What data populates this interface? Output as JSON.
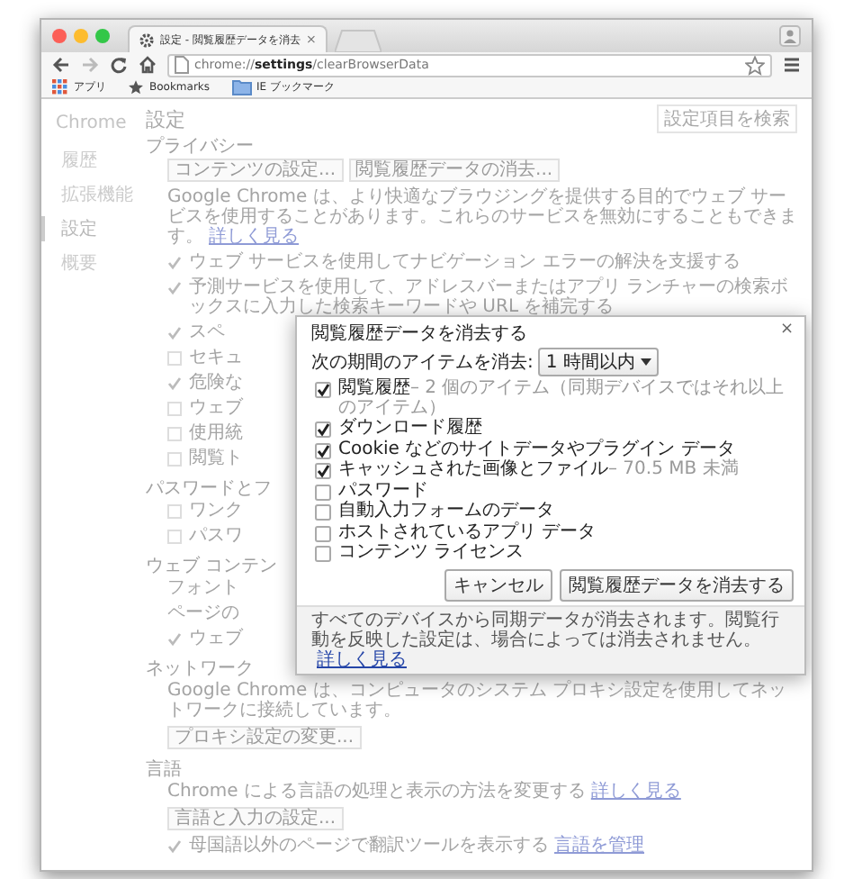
{
  "window": {
    "tab": {
      "title": "設定 - 閲覧履歴データを消去",
      "close": "×"
    },
    "address": {
      "scheme": "chrome://",
      "host": "settings",
      "path": "/clearBrowserData"
    },
    "bookmarks": [
      {
        "kind": "apps",
        "label": "アプリ"
      },
      {
        "kind": "star",
        "label": "Bookmarks"
      },
      {
        "kind": "folder",
        "label": "IE ブックマーク"
      }
    ]
  },
  "sidebar": {
    "title": "Chrome",
    "items": [
      {
        "label": "履歴",
        "selected": false
      },
      {
        "label": "拡張機能",
        "selected": false
      },
      {
        "label": "設定",
        "selected": true
      },
      {
        "label": "概要",
        "selected": false
      }
    ]
  },
  "settings": {
    "title": "設定",
    "search_placeholder": "設定項目を検索",
    "sections": [
      {
        "title": "プライバシー",
        "rows": [
          {
            "kind": "buttons",
            "buttons": [
              "コンテンツの設定...",
              "閲覧履歴データの消去..."
            ]
          },
          {
            "kind": "text",
            "text": "Google Chrome は、より快適なブラウジングを提供する目的でウェブ サービスを使用することがあります。これらのサービスを無効にすることもできます。",
            "link": "詳しく見る"
          },
          {
            "kind": "check",
            "checked": true,
            "text": "ウェブ サービスを使用してナビゲーション エラーの解決を支援する"
          },
          {
            "kind": "check",
            "checked": true,
            "text": "予測サービスを使用して、アドレスバーまたはアプリ ランチャーの検索ボックスに入力した検索キーワードや URL を補完する"
          },
          {
            "kind": "check",
            "checked": true,
            "text": "スペ"
          },
          {
            "kind": "check",
            "checked": false,
            "text": "セキュ"
          },
          {
            "kind": "check",
            "checked": true,
            "text": "危険な"
          },
          {
            "kind": "check",
            "checked": false,
            "text": "ウェブ"
          },
          {
            "kind": "check",
            "checked": false,
            "text": "使用統"
          },
          {
            "kind": "check",
            "checked": false,
            "text": "閲覧ト"
          }
        ]
      },
      {
        "title": "パスワードとフ",
        "rows": [
          {
            "kind": "check",
            "checked": false,
            "text": "ワンク"
          },
          {
            "kind": "check",
            "checked": false,
            "text": "パスワ"
          }
        ]
      },
      {
        "title": "ウェブ コンテン",
        "rows": [
          {
            "kind": "text",
            "text": "フォント"
          },
          {
            "kind": "text",
            "text": "ページの"
          },
          {
            "kind": "check",
            "checked": true,
            "text": "ウェブ"
          }
        ]
      },
      {
        "title": "ネットワーク",
        "rows": [
          {
            "kind": "text",
            "text": "Google Chrome は、コンピュータのシステム プロキシ設定を使用してネットワークに接続しています。"
          },
          {
            "kind": "buttons",
            "buttons": [
              "プロキシ設定の変更..."
            ]
          }
        ]
      },
      {
        "title": "言語",
        "rows": [
          {
            "kind": "text",
            "text": "Chrome による言語の処理と表示の方法を変更する",
            "link": "詳しく見る"
          },
          {
            "kind": "buttons",
            "buttons": [
              "言語と入力の設定..."
            ]
          },
          {
            "kind": "check",
            "checked": true,
            "text": "母国語以外のページで翻訳ツールを表示する",
            "link": "言語を管理"
          }
        ]
      }
    ]
  },
  "dialog": {
    "title": "閲覧履歴データを消去する",
    "close": "×",
    "period_label": "次の期間のアイテムを消去:",
    "period": "1 時間以内",
    "items": [
      {
        "label": "閲覧履歴",
        "note": "– 2 個のアイテム（同期デバイスではそれ以上のアイテム）",
        "checked": true
      },
      {
        "label": "ダウンロード履歴",
        "checked": true
      },
      {
        "label": "Cookie などのサイトデータやプラグイン データ",
        "checked": true
      },
      {
        "label": "キャッシュされた画像とファイル",
        "note": "– 70.5 MB 未満",
        "checked": true
      },
      {
        "label": "パスワード",
        "checked": false
      },
      {
        "label": "自動入力フォームのデータ",
        "checked": false
      },
      {
        "label": "ホストされているアプリ データ",
        "checked": false
      },
      {
        "label": "コンテンツ ライセンス",
        "checked": false
      }
    ],
    "buttons": [
      "キャンセル",
      "閲覧履歴データを消去する"
    ],
    "footer": "すべてのデバイスから同期データが消去されます。閲覧行動を反映した設定は、場合によっては消去されません。",
    "footer_link": "詳しく見る"
  }
}
